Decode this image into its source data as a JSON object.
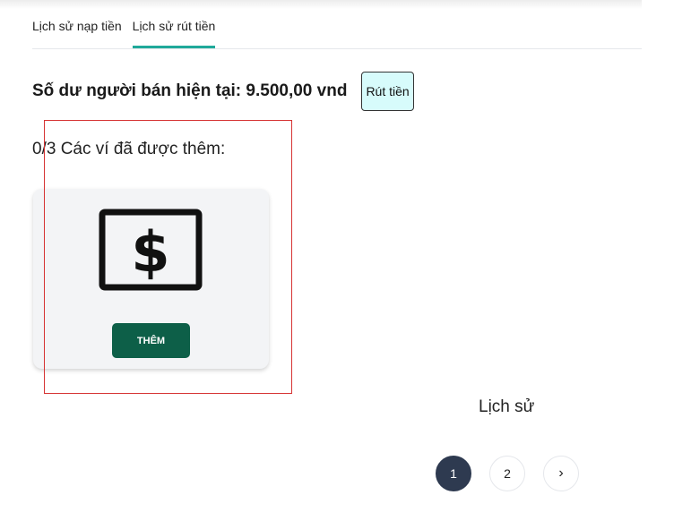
{
  "tabs": [
    {
      "label": "Lịch sử nạp tiền",
      "active": false
    },
    {
      "label": "Lịch sử rút tiền",
      "active": true
    }
  ],
  "balance": {
    "label": "Số dư người bán hiện tại: 9.500,00 vnd",
    "withdraw_label": "Rút tiền"
  },
  "wallets": {
    "count_label": "0/3 Các ví đã được thêm:",
    "card_icon": "money-icon",
    "add_label": "THÊM"
  },
  "history": {
    "title": "Lịch sử"
  },
  "pagination": {
    "pages": [
      "1",
      "2"
    ],
    "current": "1",
    "next_icon": "chevron-right-icon",
    "next_glyph": "›"
  },
  "colors": {
    "tab_underline": "#1fa99a",
    "withdraw_bg": "#d7fbfb",
    "add_button_bg": "#0d5f48",
    "active_page_bg": "#2e3a50",
    "highlight_box": "#d63333"
  }
}
